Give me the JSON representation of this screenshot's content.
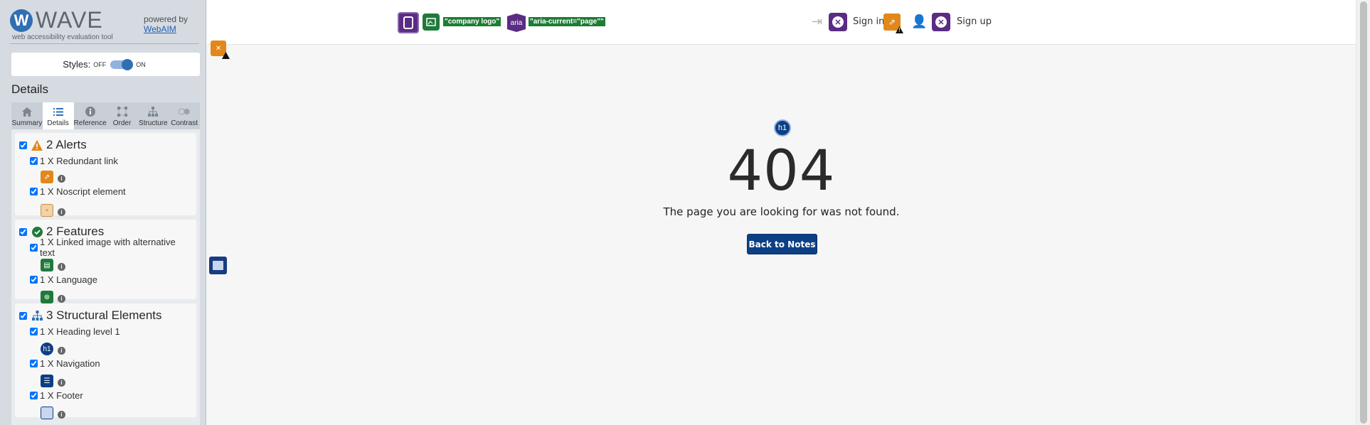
{
  "wave": {
    "logo_letter": "W",
    "name": "WAVE",
    "tagline": "web accessibility evaluation tool",
    "powered_by": "powered by",
    "powered_link": "WebAIM",
    "styles_label": "Styles:",
    "styles_off": "OFF",
    "styles_on": "ON",
    "details_title": "Details",
    "tabs": [
      {
        "label": "Summary",
        "icon": "home-icon"
      },
      {
        "label": "Details",
        "icon": "list-icon"
      },
      {
        "label": "Reference",
        "icon": "info-icon"
      },
      {
        "label": "Order",
        "icon": "order-icon"
      },
      {
        "label": "Structure",
        "icon": "structure-icon"
      },
      {
        "label": "Contrast",
        "icon": "contrast-icon"
      }
    ],
    "sections": {
      "alerts": {
        "title": "2 Alerts",
        "items": [
          "1 X Redundant link",
          "1 X Noscript element"
        ]
      },
      "features": {
        "title": "2 Features",
        "items": [
          "1 X Linked image with alternative text",
          "1 X Language"
        ]
      },
      "structure": {
        "title": "3 Structural Elements",
        "items": [
          "1 X Heading level 1",
          "1 X Navigation",
          "1 X Footer"
        ]
      }
    },
    "colors": {
      "alert": "#e2871a",
      "feature": "#1f7a3a",
      "structure": "#0d3f84",
      "aria": "#5b2c83"
    }
  },
  "page": {
    "company_logo_label": "\"company logo\"",
    "aria_chip": "aria",
    "aria_current_label": "\"aria-current=\"page\"\"",
    "sign_in": "Sign in",
    "sign_up": "Sign up",
    "h1_chip": "h1",
    "error_code": "404",
    "message": "The page you are looking for was not found.",
    "back_button": "Back to Notes"
  }
}
